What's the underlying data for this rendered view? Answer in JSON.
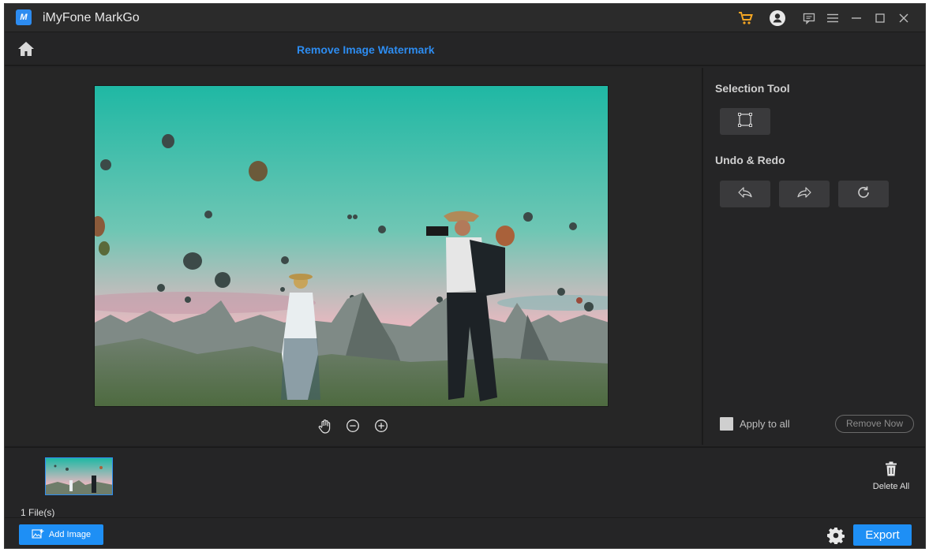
{
  "app": {
    "title": "iMyFone MarkGo",
    "logo_text": "M"
  },
  "titlebar": {
    "icons": [
      "cart-icon",
      "account-icon",
      "feedback-icon",
      "menu-icon",
      "minimize-icon",
      "maximize-icon",
      "close-icon"
    ],
    "cart_color": "#f5a623"
  },
  "header": {
    "page_title": "Remove Image Watermark",
    "accent": "#2d8cf0"
  },
  "canvas": {
    "view_tools": [
      "hand-icon",
      "zoom-out-icon",
      "zoom-in-icon"
    ]
  },
  "panel": {
    "selection_title": "Selection Tool",
    "selection_tools": [
      "rectangle-select-icon"
    ],
    "undo_title": "Undo & Redo",
    "undo_tools": [
      "undo-icon",
      "redo-icon",
      "reset-icon"
    ],
    "apply_all_label": "Apply to all",
    "apply_all_checked": false,
    "remove_now_label": "Remove Now"
  },
  "files": {
    "count_label": "1 File(s)",
    "delete_all_label": "Delete All"
  },
  "footer": {
    "add_image_label": "Add Image",
    "export_label": "Export",
    "button_color": "#1e8ff5"
  }
}
